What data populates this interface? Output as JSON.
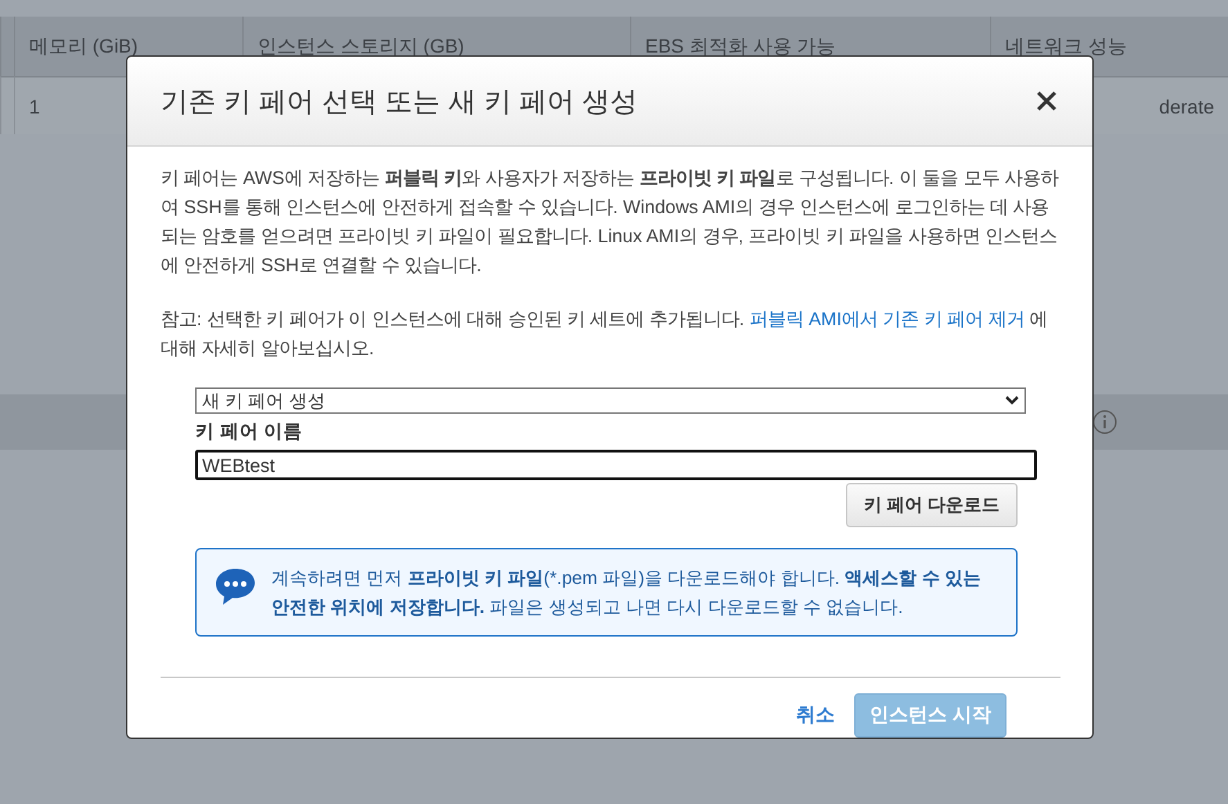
{
  "background_table": {
    "columns": [
      "메모리 (GiB)",
      "인스턴스 스토리지 (GB)",
      "EBS 최적화 사용 가능",
      "네트워크 성능"
    ],
    "rows": [
      {
        "memory": "1",
        "network_performance": "derate"
      }
    ]
  },
  "dialog": {
    "title": "기존 키 페어 선택 또는 새 키 페어 생성",
    "description": "키 페어는 AWS에 저장하는 **퍼블릭 키**와 사용자가 저장하는 **프라이빗 키 파일**로 구성됩니다. 이 둘을 모두 사용하여 SSH를 통해 인스턴스에 안전하게 접속할 수 있습니다. Windows AMI의 경우 인스턴스에 로그인하는 데 사용되는 암호를 얻으려면 프라이빗 키 파일이 필요합니다. Linux AMI의 경우, 프라이빗 키 파일을 사용하면 인스턴스에 안전하게 SSH로 연결할 수 있습니다.",
    "note": {
      "text": "참고: 선택한 키 페어가 이 인스턴스에 대해 승인된 키 세트에 추가됩니다.",
      "link": "퍼블릭 AMI에서 기존 키 페어 제거",
      "suffix": "에 대해 자세히 알아보십시오."
    },
    "key_pair_select": {
      "value": "새 키 페어 생성"
    },
    "name_field": {
      "label": "키 페어 이름",
      "value": "WEBtest"
    },
    "download_button": "키 페어 다운로드",
    "info_message": "계속하려면 먼저 **프라이빗 키 파일**(*.pem 파일)을 다운로드해야 합니다. **액세스할 수 있는 안전한 위치에 저장합니다.** 파일은 생성되고 나면 다시 다운로드할 수 없습니다.",
    "cancel_link": "취소",
    "launch_button": {
      "label": "인스턴스 시작",
      "disabled": true
    }
  }
}
